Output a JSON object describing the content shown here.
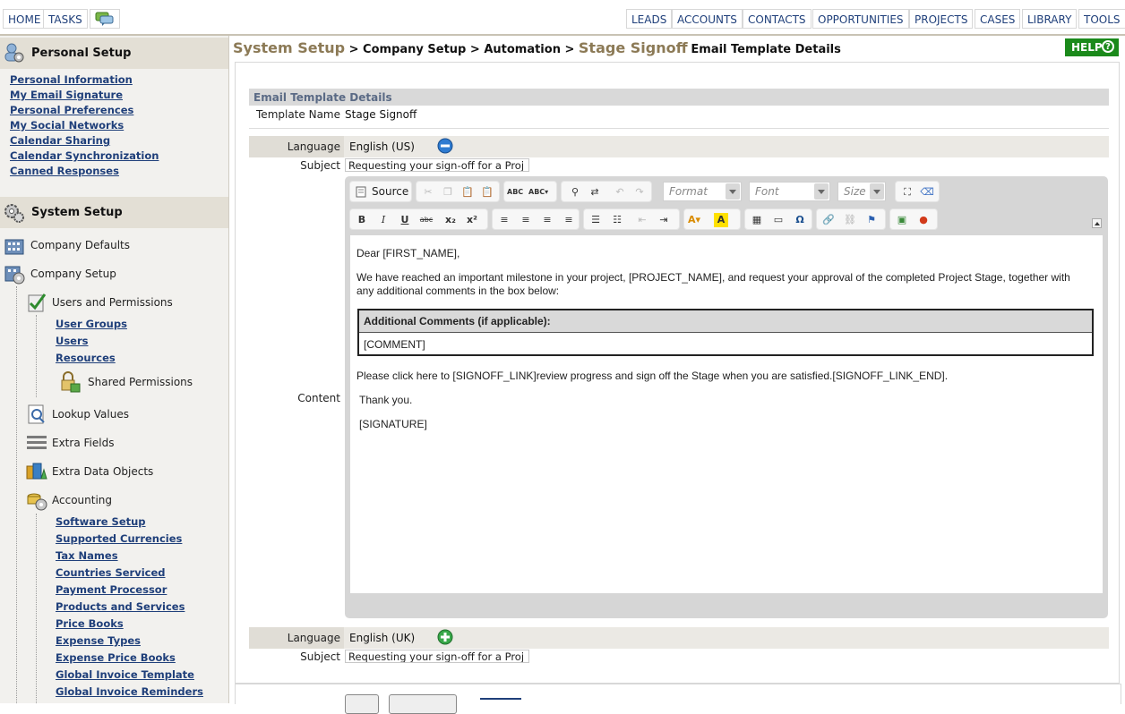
{
  "topnav": {
    "left": [
      {
        "label": "HOME"
      },
      {
        "label": "TASKS"
      }
    ],
    "right": [
      {
        "label": "LEADS"
      },
      {
        "label": "ACCOUNTS"
      },
      {
        "label": "CONTACTS"
      },
      {
        "label": "OPPORTUNITIES"
      },
      {
        "label": "PROJECTS"
      },
      {
        "label": "CASES"
      },
      {
        "label": "LIBRARY"
      },
      {
        "label": "TOOLS"
      }
    ]
  },
  "sidebar": {
    "personal_setup": {
      "title": "Personal Setup",
      "links": [
        "Personal Information",
        "My Email Signature",
        "Personal Preferences",
        "My Social Networks",
        "Calendar Sharing",
        "Calendar Synchronization",
        "Canned Responses"
      ]
    },
    "system_setup": {
      "title": "System Setup",
      "company_defaults": "Company Defaults",
      "company_setup": "Company Setup",
      "users_permissions": "Users and Permissions",
      "user_links": [
        "User Groups",
        "Users",
        "Resources"
      ],
      "shared_permissions": "Shared Permissions",
      "lookup_values": "Lookup Values",
      "extra_fields": "Extra Fields",
      "extra_data_objects": "Extra Data Objects",
      "accounting": "Accounting",
      "accounting_links": [
        "Software Setup",
        "Supported Currencies",
        "Tax Names",
        "Countries Serviced",
        "Payment Processor",
        "Products and Services",
        "Price Books",
        "Expense Types",
        "Expense Price Books",
        "Global Invoice Template",
        "Global Invoice Reminders"
      ]
    }
  },
  "breadcrumb": {
    "system_setup": "System Setup",
    "sep": " > ",
    "company_setup": "Company Setup",
    "automation": "Automation",
    "stage_signoff": "Stage Signoff",
    "tail": "Email Template Details"
  },
  "help": {
    "label": "HELP",
    "q": "?"
  },
  "form": {
    "section_title": "Email Template Details",
    "template_name_label": "Template Name",
    "template_name_value": "Stage Signoff",
    "language_label": "Language",
    "subject_label": "Subject",
    "content_label": "Content",
    "lang1": "English (US)",
    "subject1": "Requesting your sign-off for a Proj",
    "lang2": "English (UK)",
    "subject2": "Requesting your sign-off for a Proj"
  },
  "toolbar": {
    "source_label": "Source",
    "format_placeholder": "Format",
    "font_placeholder": "Font",
    "size_placeholder": "Size"
  },
  "email": {
    "greeting": "Dear [FIRST_NAME],",
    "para1_line1": "We have reached an important milestone in your project, [PROJECT_NAME], and request your approval of the completed Project Stage, together with",
    "para1_line2": "any additional comments in the box below:",
    "table_header": "Additional Comments (if applicable):",
    "table_cell": "[COMMENT]",
    "signoff": "Please click here to [SIGNOFF_LINK]review progress and sign off the Stage when you are satisfied.[SIGNOFF_LINK_END].",
    "thanks": "Thank you.",
    "signature": "[SIGNATURE]"
  },
  "colors": {
    "brand_brown": "#8c7a56",
    "help_green": "#1b8a1b",
    "link_blue": "#1f3f7a"
  }
}
